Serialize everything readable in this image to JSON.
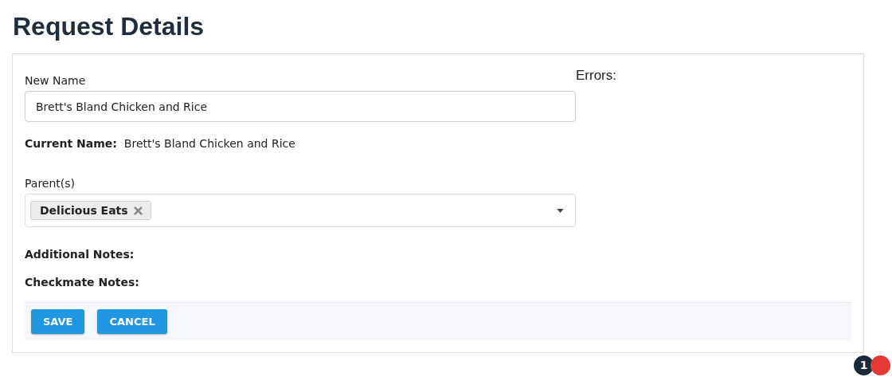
{
  "page": {
    "title": "Request Details"
  },
  "form": {
    "new_name": {
      "label": "New Name",
      "value": "Brett's Bland Chicken and Rice"
    },
    "current_name": {
      "label": "Current Name:",
      "value": "Brett's Bland Chicken and Rice"
    },
    "parents": {
      "label": "Parent(s)",
      "tags": [
        {
          "label": "Delicious Eats"
        }
      ]
    },
    "notes": [
      {
        "label": "Additional Notes:"
      },
      {
        "label": "Checkmate Notes:"
      }
    ],
    "buttons": [
      {
        "label": "SAVE"
      },
      {
        "label": "CANCEL"
      }
    ]
  },
  "errors": {
    "label": "Errors:"
  },
  "badges": [
    {
      "count": "1",
      "color": "#1b2a3b"
    },
    {
      "color": "#e53935"
    }
  ]
}
